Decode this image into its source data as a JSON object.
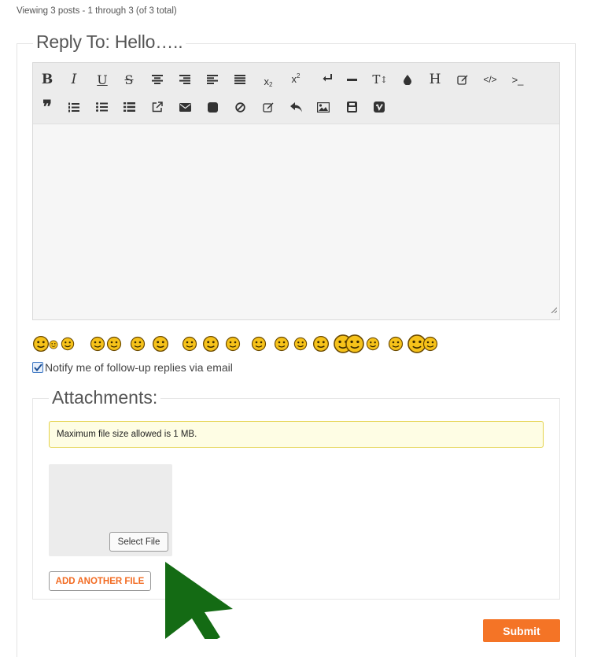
{
  "header": {
    "viewing_text": "Viewing 3 posts - 1 through 3 (of 3 total)"
  },
  "reply": {
    "legend": "Reply To: Hello….."
  },
  "toolbar": {
    "row1": [
      "bold-icon",
      "italic-icon",
      "underline-icon",
      "strikethrough-icon",
      "align-center-icon",
      "align-right-icon",
      "align-left-icon",
      "align-justify-icon",
      "subscript-icon",
      "superscript-icon",
      "line-break-icon",
      "horizontal-rule-icon",
      "text-size-icon",
      "text-color-icon",
      "heading-icon",
      "edit-icon",
      "code-icon",
      "terminal-icon"
    ],
    "row2": [
      "quote-icon",
      "ordered-list-icon",
      "unordered-list-icon",
      "list-icon",
      "external-link-icon",
      "email-icon",
      "stop-icon",
      "cancel-icon",
      "edit-icon",
      "undo-icon",
      "image-icon",
      "youtube-icon",
      "vimeo-icon"
    ]
  },
  "editor": {
    "content": ""
  },
  "smilies": [
    "smiley",
    "smiley",
    "smiley",
    "smiley",
    "smiley",
    "smiley",
    "smiley",
    "smiley",
    "smiley",
    "smiley",
    "smiley",
    "smiley",
    "smiley",
    "smiley",
    "smiley",
    "smiley",
    "smiley",
    "smiley",
    "smiley",
    "smiley"
  ],
  "notify": {
    "label": "Notify me of follow-up replies via email",
    "checked": true
  },
  "attachments": {
    "legend": "Attachments:",
    "notice": "Maximum file size allowed is 1 MB.",
    "select_file": "Select File",
    "add_another": "ADD ANOTHER FILE"
  },
  "submit": {
    "label": "Submit"
  },
  "colors": {
    "accent": "#f47426",
    "cursor": "#146b14",
    "notice_bg": "#fefde4"
  }
}
